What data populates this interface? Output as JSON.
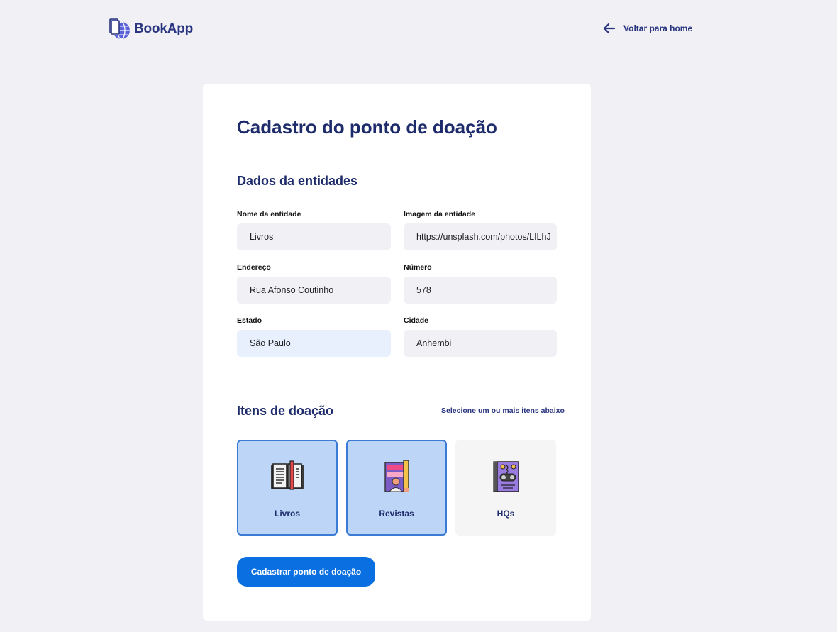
{
  "header": {
    "logo_text": "BookApp",
    "back_label": "Voltar para home"
  },
  "form": {
    "title": "Cadastro do ponto de doação",
    "section_entity": "Dados da entidades",
    "fields": {
      "name": {
        "label": "Nome da entidade",
        "value": "Livros"
      },
      "image": {
        "label": "Imagem da entidade",
        "value": "https://unsplash.com/photos/LILhJ"
      },
      "address": {
        "label": "Endereço",
        "value": "Rua Afonso Coutinho"
      },
      "number": {
        "label": "Número",
        "value": "578"
      },
      "state": {
        "label": "Estado",
        "value": "São Paulo"
      },
      "city": {
        "label": "Cidade",
        "value": "Anhembi"
      }
    },
    "section_items": "Itens de doação",
    "items_hint": "Selecione um ou mais itens abaixo",
    "items": [
      {
        "label": "Livros",
        "icon": "open-book-icon",
        "selected": true
      },
      {
        "label": "Revistas",
        "icon": "magazine-icon",
        "selected": true
      },
      {
        "label": "HQs",
        "icon": "comic-book-icon",
        "selected": false
      }
    ],
    "submit_label": "Cadastrar ponto de doação"
  },
  "colors": {
    "background": "#f0f0f5",
    "primary_text": "#1d2b6b",
    "accent": "#0a6fe0",
    "selected_bg": "#bdd6f7",
    "selected_border": "#3a7bd5"
  }
}
